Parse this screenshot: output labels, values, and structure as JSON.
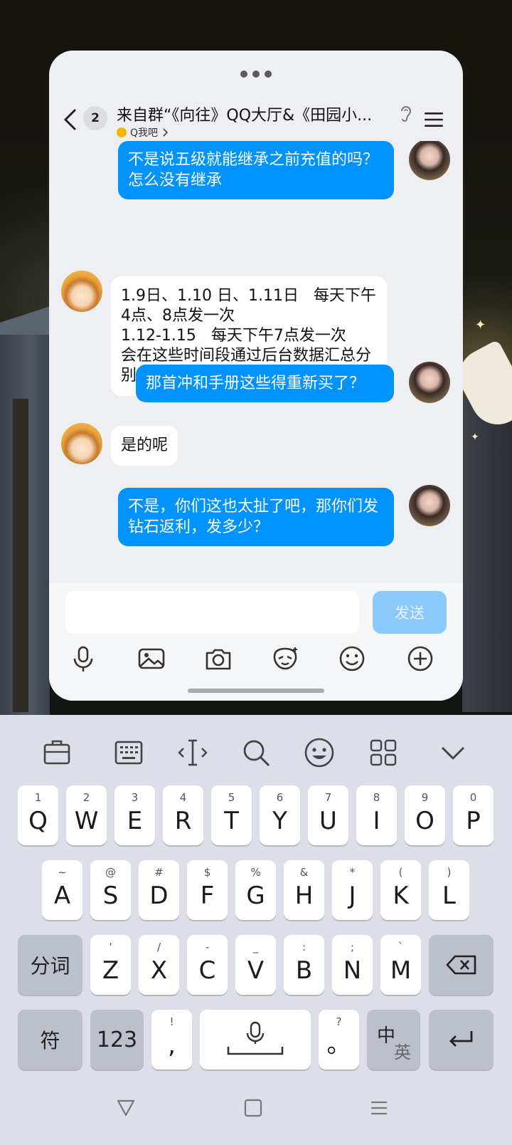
{
  "chat": {
    "unread_count": "2",
    "title": "来自群“《向往》QQ大厅&《田园小...",
    "subtitle": "Q我吧",
    "messages": [
      {
        "side": "me",
        "text": "不是说五级就能继承之前充值的吗？怎么没有继承"
      },
      {
        "side": "other",
        "text": "1.9日、1.10 日、1.11日   每天下午4点、8点发一次\n1.12-1.15   每天下午7点发一次\n会在这些时间段通过后台数据汇总分别给玩家邮件发放钻石返利"
      },
      {
        "side": "me",
        "text": "那首冲和手册这些得重新买了？"
      },
      {
        "side": "other",
        "text": "是的呢"
      },
      {
        "side": "me",
        "text": "不是，你们这也太扯了吧，那你们发钻石返利，发多少？"
      }
    ],
    "input_value": "",
    "send_label": "发送",
    "toolbar_icons": [
      "microphone-icon",
      "image-icon",
      "camera-icon",
      "sticker-icon",
      "emoji-icon",
      "plus-icon"
    ]
  },
  "keyboard": {
    "toolbar_icons": [
      "clipboard-icon",
      "keyboard-layout-icon",
      "text-cursor-icon",
      "search-icon",
      "emoji-icon",
      "grid-icon",
      "collapse-icon"
    ],
    "row1": [
      {
        "hint": "1",
        "main": "Q"
      },
      {
        "hint": "2",
        "main": "W"
      },
      {
        "hint": "3",
        "main": "E"
      },
      {
        "hint": "4",
        "main": "R"
      },
      {
        "hint": "5",
        "main": "T"
      },
      {
        "hint": "6",
        "main": "Y"
      },
      {
        "hint": "7",
        "main": "U"
      },
      {
        "hint": "8",
        "main": "I"
      },
      {
        "hint": "9",
        "main": "O"
      },
      {
        "hint": "0",
        "main": "P"
      }
    ],
    "row2": [
      {
        "hint": "~",
        "main": "A"
      },
      {
        "hint": "@",
        "main": "S"
      },
      {
        "hint": "#",
        "main": "D"
      },
      {
        "hint": "$",
        "main": "F"
      },
      {
        "hint": "%",
        "main": "G"
      },
      {
        "hint": "&",
        "main": "H"
      },
      {
        "hint": "*",
        "main": "J"
      },
      {
        "hint": "(",
        "main": "K"
      },
      {
        "hint": ")",
        "main": "L"
      }
    ],
    "row3": [
      {
        "hint": "'",
        "main": "Z"
      },
      {
        "hint": "/",
        "main": "X"
      },
      {
        "hint": "-",
        "main": "C"
      },
      {
        "hint": "_",
        "main": "V"
      },
      {
        "hint": ":",
        "main": "B"
      },
      {
        "hint": ";",
        "main": "N"
      },
      {
        "hint": "`",
        "main": "M"
      }
    ],
    "fenci_label": "分词",
    "symbol_label": "符",
    "numbers_label": "123",
    "comma": {
      "hint": "!",
      "main": ","
    },
    "period": {
      "hint": "?",
      "main": "。"
    },
    "lang_top": "中",
    "lang_bottom": "英"
  }
}
